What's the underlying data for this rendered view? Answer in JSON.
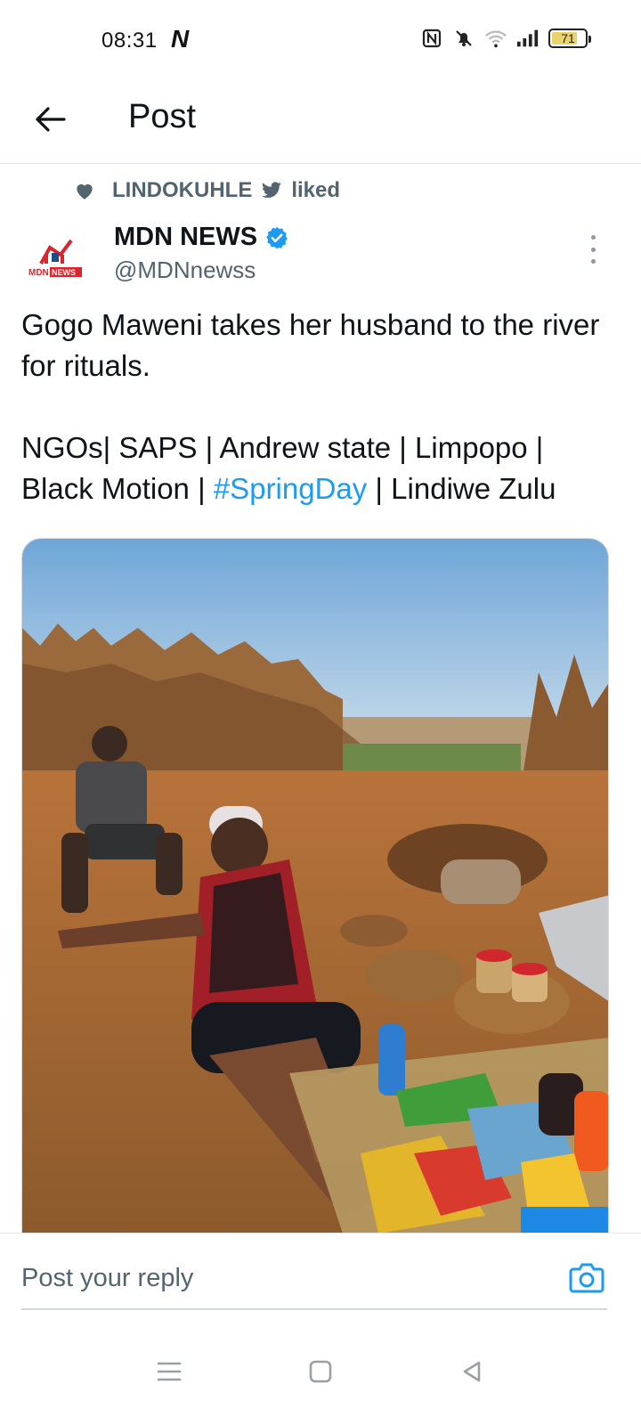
{
  "status_bar": {
    "time": "08:31",
    "battery_level": "71",
    "icons": [
      "nfc-icon",
      "mute-icon",
      "wifi-icon",
      "signal-icon",
      "battery-icon"
    ]
  },
  "header": {
    "title": "Post"
  },
  "social_context": {
    "user": "LINDOKUHLE",
    "action": "liked"
  },
  "author": {
    "name": "MDN NEWS",
    "handle": "@MDNnewss",
    "verified": true,
    "avatar_text": "MDN NEWS"
  },
  "tweet": {
    "line1": "Gogo Maweni takes her husband to the river for rituals.",
    "line2_before": "NGOs| SAPS | Andrew state | Limpopo | Black Motion | ",
    "hashtag": "#SpringDay",
    "line2_after": " | Lindiwe Zulu"
  },
  "reply": {
    "placeholder": "Post your reply"
  },
  "colors": {
    "accent": "#1d9bf0",
    "secondary_text": "#536471",
    "primary_text": "#0f1419"
  }
}
